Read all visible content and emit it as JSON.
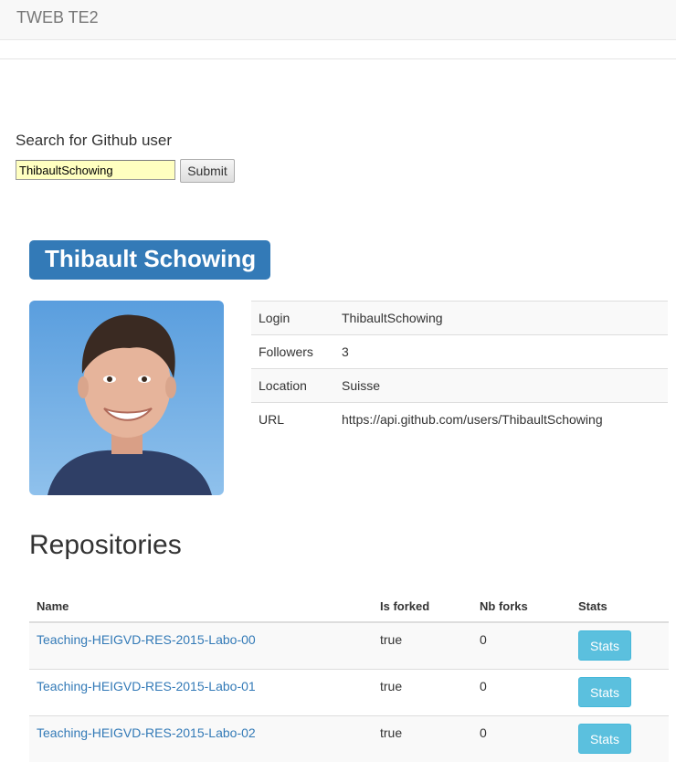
{
  "navbar": {
    "brand": "TWEB TE2"
  },
  "search": {
    "label": "Search for Github user",
    "input_value": "ThibaultSchowing",
    "submit_label": "Submit"
  },
  "user": {
    "name": "Thibault Schowing",
    "details": [
      {
        "key": "Login",
        "value": "ThibaultSchowing"
      },
      {
        "key": "Followers",
        "value": "3"
      },
      {
        "key": "Location",
        "value": "Suisse"
      },
      {
        "key": "URL",
        "value": "https://api.github.com/users/ThibaultSchowing"
      }
    ]
  },
  "repositories": {
    "heading": "Repositories",
    "columns": [
      "Name",
      "Is forked",
      "Nb forks",
      "Stats"
    ],
    "rows": [
      {
        "name": "Teaching-HEIGVD-RES-2015-Labo-00",
        "is_forked": "true",
        "nb_forks": "0",
        "stats_label": "Stats"
      },
      {
        "name": "Teaching-HEIGVD-RES-2015-Labo-01",
        "is_forked": "true",
        "nb_forks": "0",
        "stats_label": "Stats"
      },
      {
        "name": "Teaching-HEIGVD-RES-2015-Labo-02",
        "is_forked": "true",
        "nb_forks": "0",
        "stats_label": "Stats"
      }
    ]
  },
  "colors": {
    "primary": "#337ab7",
    "info": "#5bc0de",
    "input_autofill": "#ffffc0"
  }
}
